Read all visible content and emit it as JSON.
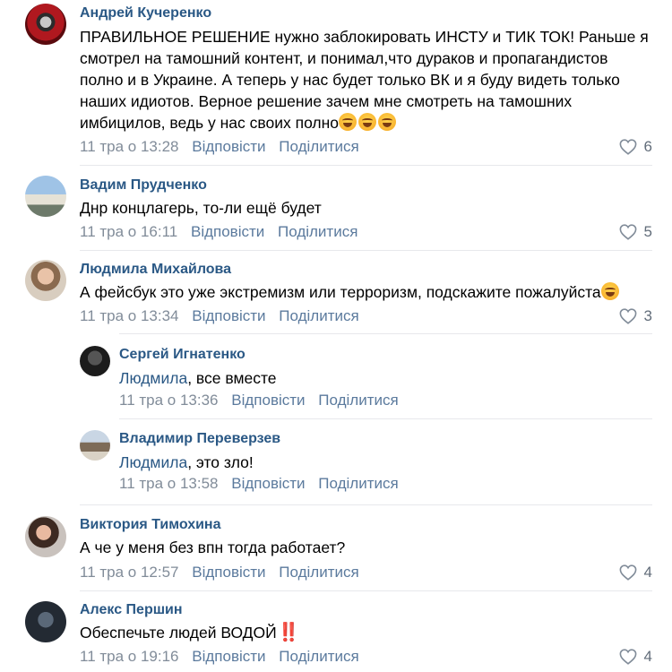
{
  "actions": {
    "reply": "Відповісти",
    "share": "Поділитися"
  },
  "comments": [
    {
      "author": "Андрей Кучеренко",
      "text": "ПРАВИЛЬНОЕ РЕШЕНИЕ нужно заблокировать ИНСТУ и ТИК ТОК! Раньше я смотрел на тамошний контент, и понимал,что дураков и пропагандистов полно и в Украине. А теперь у нас будет только ВК и я буду видеть только наших идиотов. Верное решение зачем мне смотреть на тамошних имбицилов, ведь у нас своих полно",
      "emoji_count": 3,
      "time": "11 тра о 13:28",
      "likes": "6"
    },
    {
      "author": "Вадим Прудченко",
      "text": "Днр концлагерь, то-ли ещё будет",
      "time": "11 тра о 16:11",
      "likes": "5"
    },
    {
      "author": "Людмила Михайлова",
      "text": "А фейсбук это уже экстремизм или терроризм, подскажите пожалуйста",
      "emoji_count": 1,
      "time": "11 тра о 13:34",
      "likes": "3"
    },
    {
      "author": "Сергей Игнатенко",
      "mention": "Людмила",
      "text": ", все вместе",
      "time": "11 тра о 13:36"
    },
    {
      "author": "Владимир Переверзев",
      "mention": "Людмила",
      "text": ", это зло!",
      "time": "11 тра о 13:58"
    },
    {
      "author": "Виктория Тимохина",
      "text": "А че у меня без впн тогда работает?",
      "time": "11 тра о 12:57",
      "likes": "4"
    },
    {
      "author": "Алекс Першин",
      "text": "Обеспечьте людей ВОДОЙ",
      "emoji": "‼️",
      "time": "11 тра о 19:16",
      "likes": "4"
    }
  ]
}
